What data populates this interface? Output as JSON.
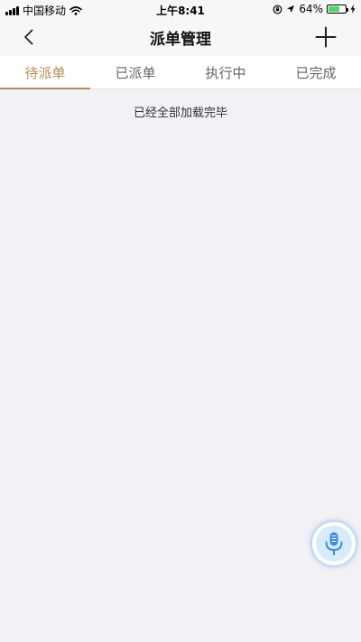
{
  "status_bar": {
    "carrier": "中国移动",
    "time": "上午8:41",
    "battery_percent": "64%",
    "battery_level": 0.64
  },
  "nav": {
    "title": "派单管理"
  },
  "tabs": [
    {
      "label": "待派单",
      "active": true
    },
    {
      "label": "已派单",
      "active": false
    },
    {
      "label": "执行中",
      "active": false
    },
    {
      "label": "已完成",
      "active": false
    }
  ],
  "content": {
    "load_status": "已经全部加载完毕"
  },
  "colors": {
    "accent": "#b78a55",
    "background": "#f2f1f6",
    "voice": "#3a8de0"
  }
}
